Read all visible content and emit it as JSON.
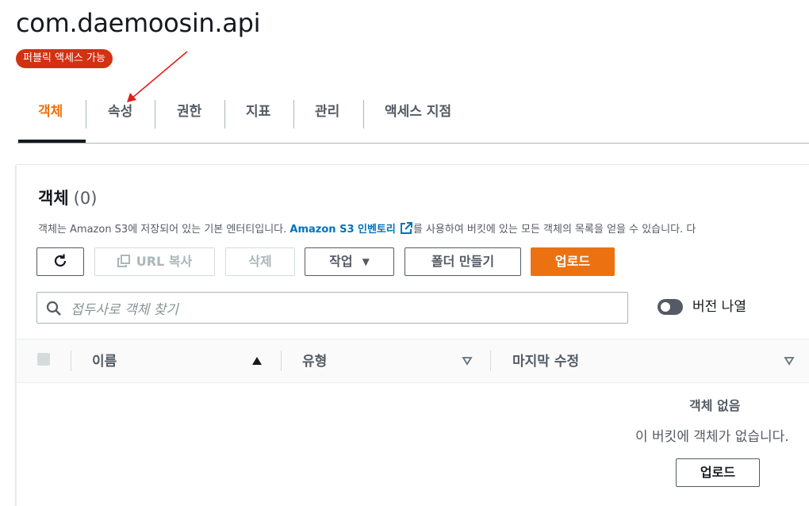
{
  "bucket": {
    "name": "com.daemoosin.api",
    "access_badge": "퍼블릭 액세스 가능"
  },
  "tabs": [
    {
      "label": "객체",
      "active": true
    },
    {
      "label": "속성"
    },
    {
      "label": "권한"
    },
    {
      "label": "지표"
    },
    {
      "label": "관리"
    },
    {
      "label": "액세스 지점"
    }
  ],
  "objects": {
    "title": "객체",
    "count": "(0)",
    "description_before": "객체는 Amazon S3에 저장되어 있는 기본 엔터티입니다.",
    "description_link": "Amazon S3 인벤토리",
    "description_after": "를 사용하여 버킷에 있는 모든 객체의 목록을 얻을 수 있습니다. 다",
    "actions": {
      "copy_url": "URL 복사",
      "delete": "삭제",
      "actions": "작업",
      "create_folder": "폴더 만들기",
      "upload": "업로드"
    },
    "search_placeholder": "접두사로 객체 찾기",
    "versions_toggle": "버전 나열",
    "columns": [
      "이름",
      "유형",
      "마지막 수정"
    ],
    "empty_title": "객체 없음",
    "empty_description": "이 버킷에 객체가 없습니다.",
    "empty_upload": "업로드"
  },
  "colors": {
    "accent": "#ec7211",
    "public_badge": "#d13212",
    "link": "#0073bb",
    "annotation_arrow": "#e0201b"
  },
  "icons": [
    "refresh-icon",
    "copy-icon",
    "caret-down-icon",
    "search-icon",
    "external-link-icon",
    "sort-ascending-icon",
    "sort-icon"
  ]
}
